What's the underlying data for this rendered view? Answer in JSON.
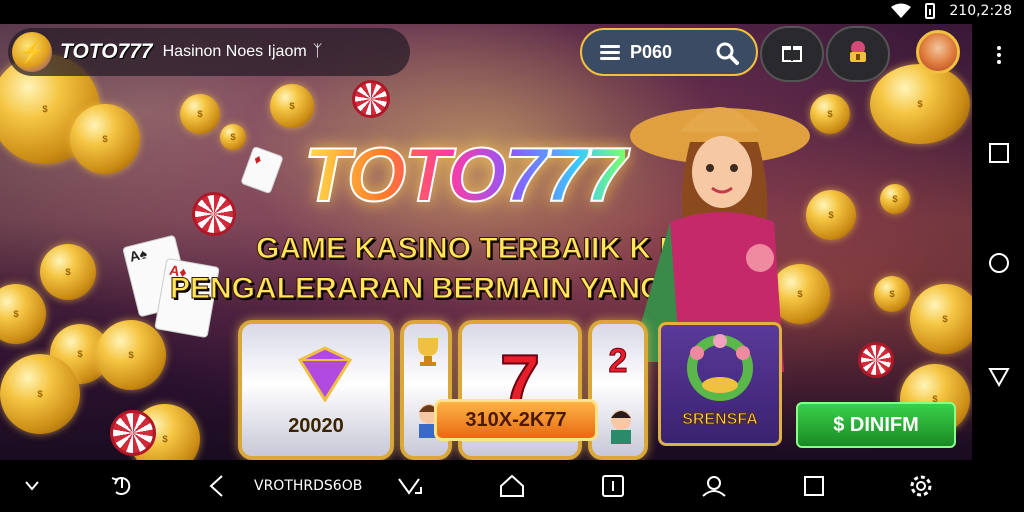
{
  "status_bar": {
    "time": "210,2:28"
  },
  "header": {
    "brand_name": "TOTO777",
    "brand_subtitle": "Hasinon Noes Ijaom",
    "brand_sub_suffix": "ᛉ",
    "search_value": "P060"
  },
  "hero": {
    "title": "TOTO777",
    "tagline_1": "GAME KASINO TERBAIIK K POTUR",
    "tagline_2": "PENGALERARAN BERMAIN YANG SERU"
  },
  "slots": {
    "reel_1_value": "20020",
    "reel_3_symbol": "7",
    "reel_4_symbol": "2",
    "bet_button": "310X-2K77",
    "bonus_label": "SRENSFA",
    "spin_button": "$ DINIFM"
  },
  "bottom_bar": {
    "center_text": "VROTHRDS6OB"
  },
  "colors": {
    "accent_gold": "#f0c040",
    "spin_green": "#1a8a24",
    "bet_orange": "#e86a12"
  }
}
